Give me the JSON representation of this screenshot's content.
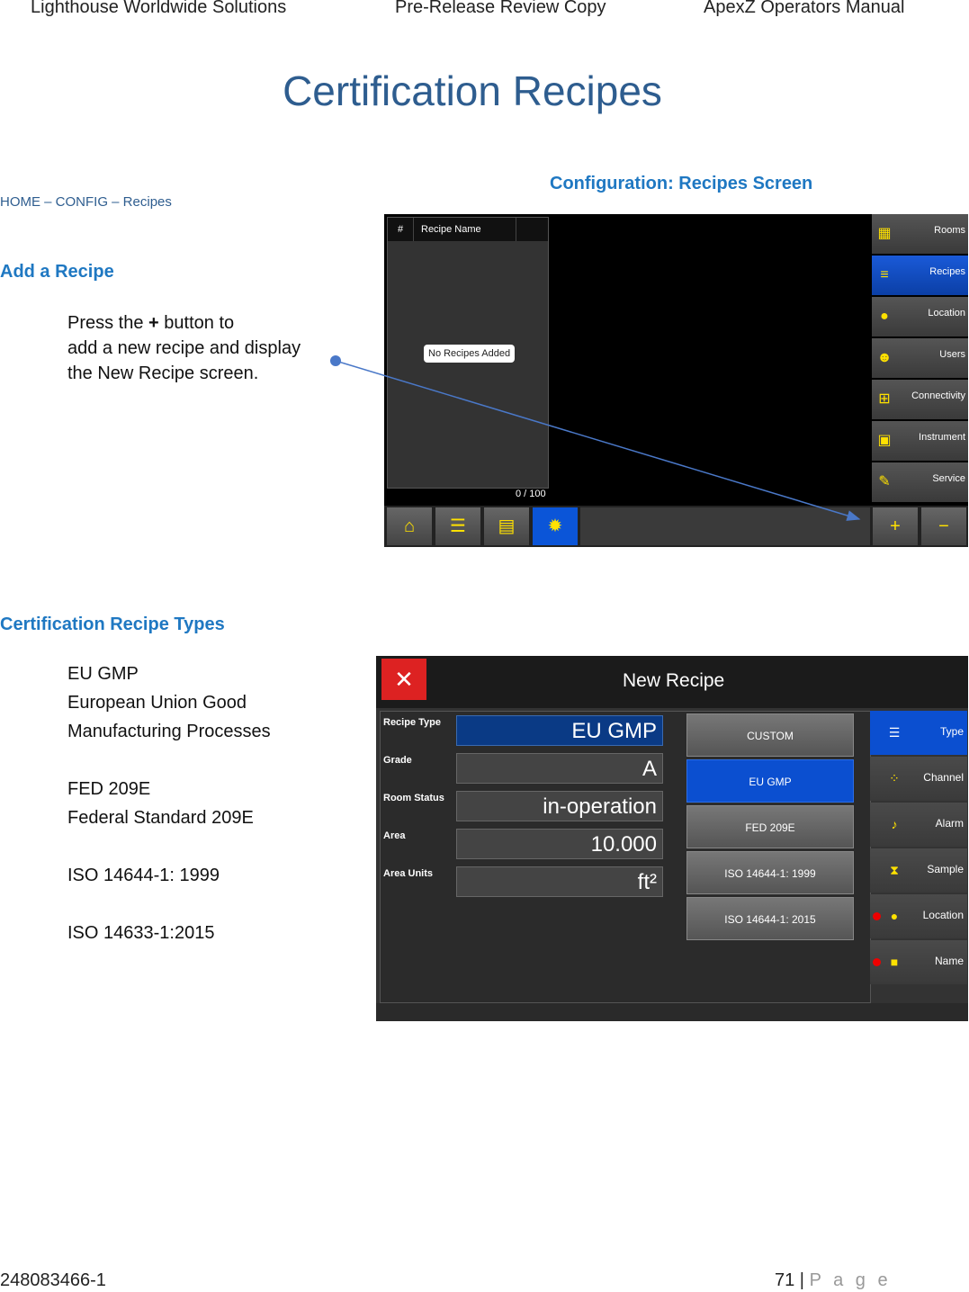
{
  "header": {
    "left": "Lighthouse Worldwide Solutions",
    "center": "Pre-Release Review Copy",
    "right": "ApexZ Operators Manual"
  },
  "title": "Certification Recipes",
  "breadcrumb": "HOME – CONFIG – Recipes",
  "add_recipe": {
    "heading": "Add a Recipe",
    "line1_pre": "Press the ",
    "line1_bold": "+",
    "line1_post": " button to",
    "line2": "add a new recipe and display",
    "line3": "the New Recipe screen."
  },
  "figure1_caption": "Configuration: Recipes Screen",
  "recipes_screen": {
    "col_num": "#",
    "col_name": "Recipe Name",
    "empty_msg": "No Recipes Added",
    "count": "0 / 100",
    "side_items": [
      {
        "label": "Rooms",
        "icon": "building-icon"
      },
      {
        "label": "Recipes",
        "icon": "list-icon"
      },
      {
        "label": "Location",
        "icon": "pin-icon"
      },
      {
        "label": "Users",
        "icon": "users-icon"
      },
      {
        "label": "Connectivity",
        "icon": "network-icon"
      },
      {
        "label": "Instrument",
        "icon": "instrument-icon"
      },
      {
        "label": "Service",
        "icon": "wrench-icon"
      }
    ]
  },
  "types_section": {
    "heading": "Certification Recipe Types",
    "eu_gmp": "EU GMP",
    "eu_desc1": "European Union Good",
    "eu_desc2": "Manufacturing Processes",
    "fed": "FED 209E",
    "fed_desc": "Federal Standard 209E",
    "iso1": "ISO 14644-1: 1999",
    "iso2": "ISO 14633-1:2015"
  },
  "new_recipe_screen": {
    "title": "New Recipe",
    "fields": [
      {
        "label": "Recipe Type",
        "value": "EU GMP"
      },
      {
        "label": "Grade",
        "value": "A"
      },
      {
        "label": "Room Status",
        "value": "in-operation"
      },
      {
        "label": "Area",
        "value": "10.000"
      },
      {
        "label": "Area Units",
        "value": "ft²"
      }
    ],
    "options": [
      "CUSTOM",
      "EU GMP",
      "FED 209E",
      "ISO 14644-1: 1999",
      "ISO 14644-1: 2015"
    ],
    "side_items": [
      {
        "label": "Type",
        "icon": "list-icon"
      },
      {
        "label": "Channel",
        "icon": "dots-icon"
      },
      {
        "label": "Alarm",
        "icon": "bell-icon"
      },
      {
        "label": "Sample",
        "icon": "hourglass-icon"
      },
      {
        "label": "Location",
        "icon": "pin-icon"
      },
      {
        "label": "Name",
        "icon": "tag-icon"
      }
    ]
  },
  "footer": {
    "doc_number": "248083466-1",
    "page_number": "71",
    "page_sep": " | ",
    "page_word": "P a g e"
  }
}
